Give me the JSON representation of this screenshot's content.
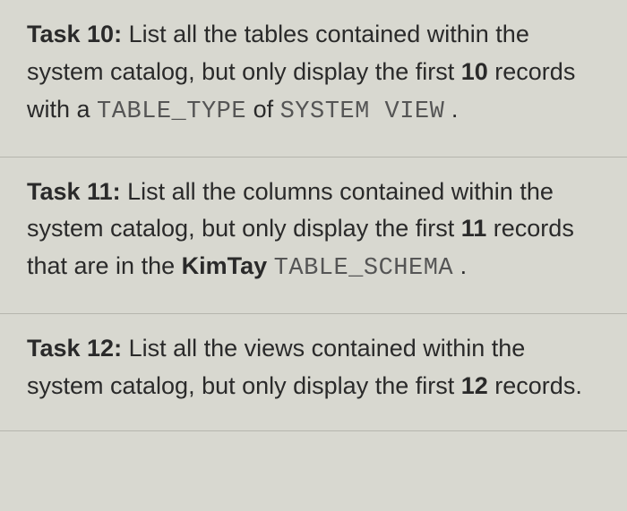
{
  "tasks": [
    {
      "label": "Task 10:",
      "text1": " List all the tables contained within the system catalog, but only display the first ",
      "num": "10",
      "text2": " records with a ",
      "code1": "TABLE_TYPE",
      "text3": " of ",
      "code2": "SYSTEM VIEW",
      "text4": " ."
    },
    {
      "label": "Task 11:",
      "text1": " List all the columns contained within the system catalog, but only display the first ",
      "num": "11",
      "text2": " records that are in the ",
      "bold1": "KimTay",
      "text3": " ",
      "code1": "TABLE_SCHEMA",
      "text4": " ."
    },
    {
      "label": "Task 12:",
      "text1": " List all the views contained within the system catalog, but only display the first ",
      "num": "12",
      "text2": " records."
    }
  ]
}
